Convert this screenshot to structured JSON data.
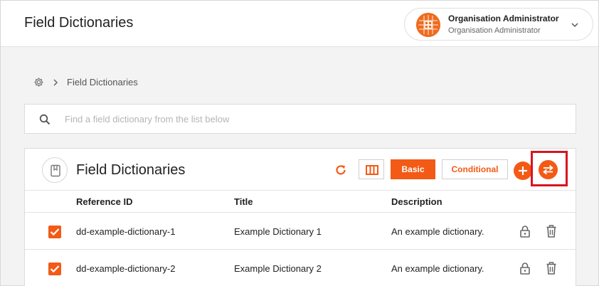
{
  "app": {
    "title": "Field Dictionaries"
  },
  "user": {
    "name": "Organisation Administrator",
    "role": "Organisation Administrator"
  },
  "breadcrumb": {
    "current": "Field Dictionaries"
  },
  "search": {
    "placeholder": "Find a field dictionary from the list below",
    "value": ""
  },
  "panel": {
    "title": "Field Dictionaries",
    "basic_label": "Basic",
    "conditional_label": "Conditional"
  },
  "table": {
    "headers": [
      "Reference ID",
      "Title",
      "Description"
    ],
    "rows": [
      {
        "reference_id": "dd-example-dictionary-1",
        "title": "Example Dictionary 1",
        "description": "An example dictionary.",
        "checked": true
      },
      {
        "reference_id": "dd-example-dictionary-2",
        "title": "Example Dictionary 2",
        "description": "An example dictionary.",
        "checked": true
      }
    ]
  },
  "colors": {
    "accent": "#f25a16",
    "highlight": "#d9141e"
  },
  "icons": {
    "breadcrumb_root": "gear-icon",
    "search": "search-icon",
    "refresh": "refresh-icon",
    "columns": "columns-icon",
    "add": "plus-icon",
    "swap": "swap-arrows-icon",
    "row_lock": "lock-icon",
    "row_delete": "trash-icon"
  }
}
